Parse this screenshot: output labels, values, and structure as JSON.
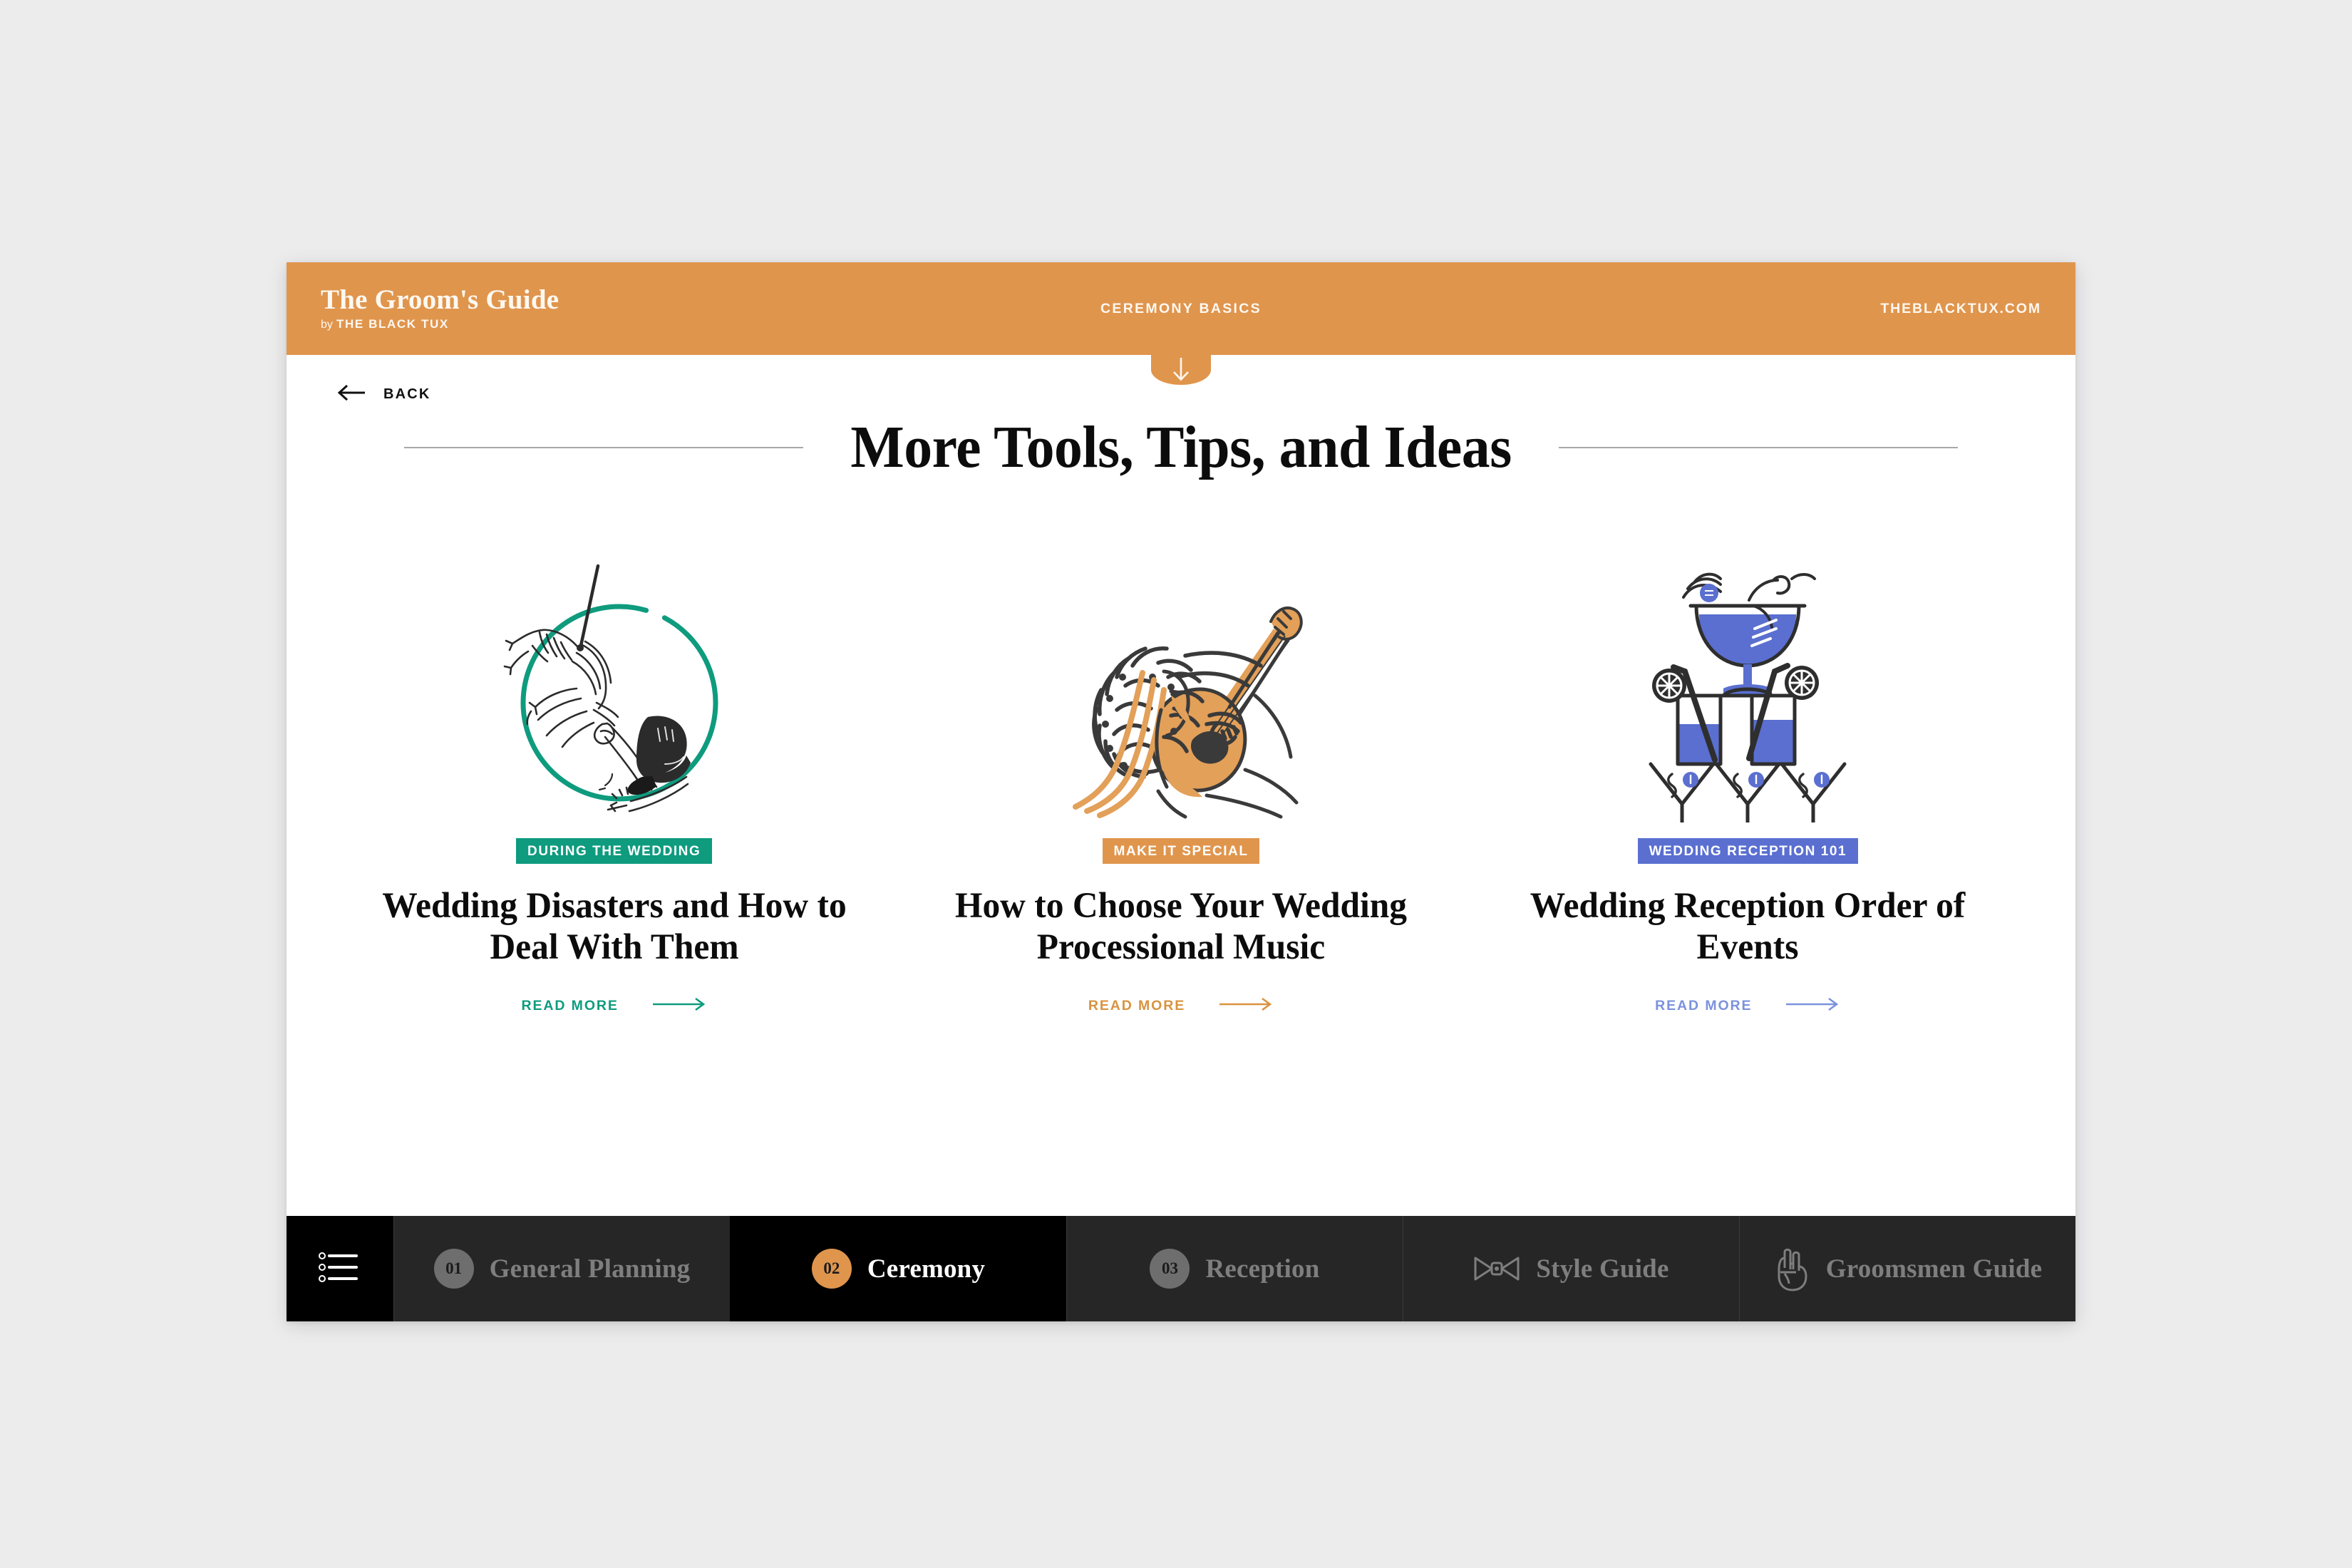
{
  "theme": {
    "orange": "#e0954d",
    "green": "#0e9b7e",
    "blue": "#5a6fd0",
    "black": "#000000",
    "page_bg": "#ececed",
    "panel_bg": "#ffffff"
  },
  "header": {
    "brand_title": "The Groom's Guide",
    "brand_by": "by",
    "brand_name": "THE BLACK TUX",
    "section_label": "CEREMONY BASICS",
    "site_url": "THEBLACKTUX.COM",
    "scroll_down_icon": "arrow-down-icon"
  },
  "toolbar": {
    "back_icon": "arrow-left-icon",
    "back_label": "BACK"
  },
  "main": {
    "page_title": "More Tools, Tips, and Ideas",
    "cards": [
      {
        "illustration": "limbo-dancer-illustration",
        "tag": "DURING THE WEDDING",
        "tag_color": "#0e9b7e",
        "headline": "Wedding Disasters and How to Deal With Them",
        "cta_label": "READ MORE",
        "cta_icon": "arrow-right-icon",
        "accent": "#0e9b7e"
      },
      {
        "illustration": "guitarist-illustration",
        "tag": "MAKE IT SPECIAL",
        "tag_color": "#e0954d",
        "headline": "How to Choose Your Wedding Processional Music",
        "cta_label": "READ MORE",
        "cta_icon": "arrow-right-icon",
        "accent": "#d9933f"
      },
      {
        "illustration": "cocktail-tower-illustration",
        "tag": "WEDDING RECEPTION 101",
        "tag_color": "#5a6fd0",
        "headline": "Wedding Reception Order of Events",
        "cta_label": "READ MORE",
        "cta_icon": "arrow-right-icon",
        "accent": "#7b92dd"
      }
    ]
  },
  "bottom_nav": {
    "menu_icon": "list-menu-icon",
    "items": [
      {
        "number": "01",
        "label": "General Planning",
        "icon": null,
        "active": false
      },
      {
        "number": "02",
        "label": "Ceremony",
        "icon": null,
        "active": true
      },
      {
        "number": "03",
        "label": "Reception",
        "icon": null,
        "active": false
      },
      {
        "number": null,
        "label": "Style Guide",
        "icon": "bowtie-icon",
        "active": false
      },
      {
        "number": null,
        "label": "Groomsmen Guide",
        "icon": "rock-hand-icon",
        "active": false
      }
    ]
  }
}
